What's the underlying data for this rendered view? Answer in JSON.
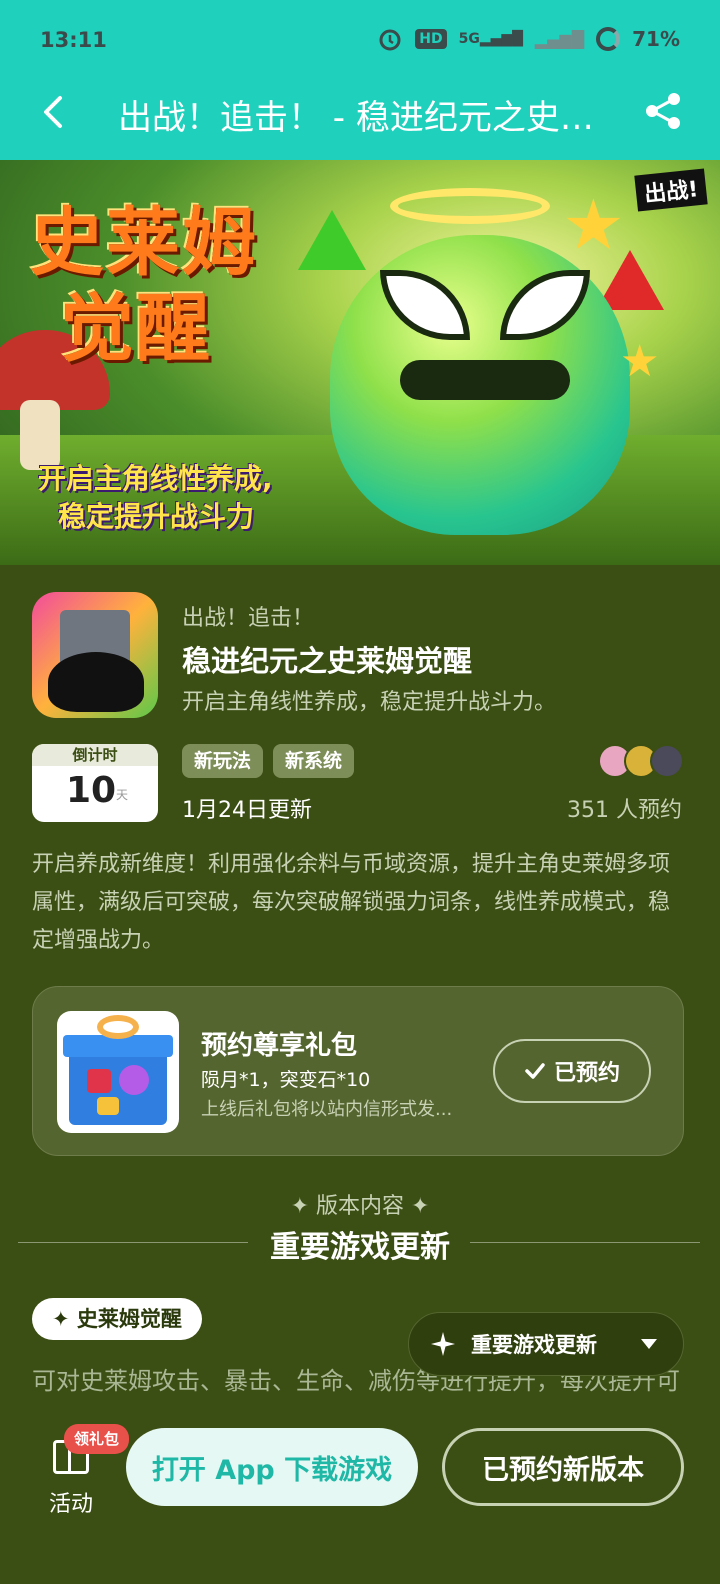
{
  "status_bar": {
    "time": "13:11",
    "network_hd": "HD",
    "network_5g": "5G",
    "battery": "71%",
    "icons": [
      "alarm-icon",
      "hd-icon",
      "signal-5g-icon",
      "signal-icon",
      "battery-ring-icon"
    ]
  },
  "title_bar": {
    "title": "出战！追击！ - 稳进纪元之史…",
    "back_icon": "chevron-left-icon",
    "share_icon": "share-icon"
  },
  "banner": {
    "logo_line1": "史莱姆",
    "logo_line2": "觉醒",
    "tagline_line1": "开启主角线性养成,",
    "tagline_line2": "稳定提升战斗力",
    "corner_logo": "出战!"
  },
  "app": {
    "developer": "出战！追击！",
    "name": "稳进纪元之史莱姆觉醒",
    "slogan": "开启主角线性养成，稳定提升战斗力。",
    "countdown_label": "倒计时",
    "countdown_value": "10",
    "countdown_unit": "天",
    "tags": [
      "新玩法",
      "新系统"
    ],
    "update_date": "1月24日更新",
    "reserve_count": "351 人预约",
    "description": "开启养成新维度！利用强化余料与币域资源，提升主角史莱姆多项属性，满级后可突破，每次突破解锁强力词条，线性养成模式，稳定增强战力。"
  },
  "gift": {
    "title": "预约尊享礼包",
    "items": "陨月*1，突变石*10",
    "note": "上线后礼包将以站内信形式发...",
    "button": "已预约"
  },
  "version": {
    "label": "✦ 版本内容 ✦",
    "title": "重要游戏更新",
    "chip": "✦ 史莱姆觉醒",
    "body": "可对史莱姆攻击、暴击、生命、减伤等进行提升，每次提升可进行升级...",
    "float_pill": "重要游戏更新"
  },
  "bottom_bar": {
    "activity_label": "活动",
    "gift_badge": "领礼包",
    "open_button": "打开 App 下载游戏",
    "reserved_version_button": "已预约新版本"
  },
  "colors": {
    "teal": "#1fd0bd",
    "page_bg": "#3b4e13",
    "card_bg": "#55652f",
    "tag_bg": "#7e8e58"
  }
}
